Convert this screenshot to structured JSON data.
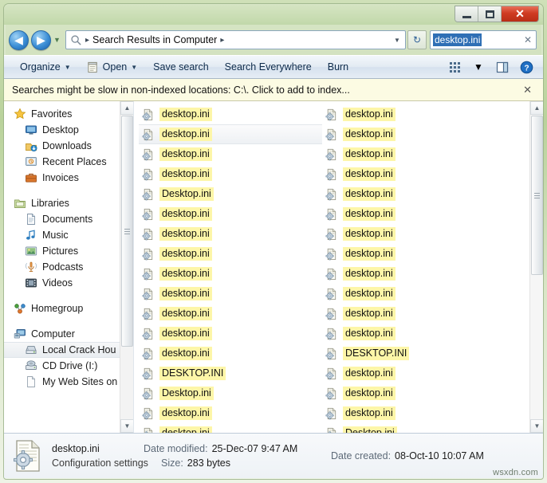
{
  "window": {
    "title": "",
    "controls": {
      "minimize": "minimize-icon",
      "maximize": "maximize-icon",
      "close": "✕"
    }
  },
  "address": {
    "back_label": "◀",
    "forward_label": "▶",
    "history_caret": "▼",
    "search_icon": "magnifier-icon",
    "crumb_sep": "▸",
    "breadcrumb": "Search Results in Computer",
    "dropdown_caret": "▼",
    "refresh_label": "↻"
  },
  "search": {
    "value": "desktop.ini",
    "clear_label": "✕"
  },
  "toolbar": {
    "organize": "Organize",
    "open": "Open",
    "save_search": "Save search",
    "search_everywhere": "Search Everywhere",
    "burn": "Burn",
    "caret": "▼",
    "views_icon": "view-options-icon",
    "preview_icon": "preview-pane-icon",
    "help_icon": "help-icon"
  },
  "notice": {
    "text": "Searches might be slow in non-indexed locations: C:\\. Click to add to index...",
    "close_label": "✕"
  },
  "sidebar": {
    "groups": [
      {
        "header": {
          "label": "Favorites",
          "icon": "star-icon"
        },
        "items": [
          {
            "label": "Desktop",
            "icon": "desktop-icon"
          },
          {
            "label": "Downloads",
            "icon": "downloads-icon"
          },
          {
            "label": "Recent Places",
            "icon": "recent-places-icon"
          },
          {
            "label": "Invoices",
            "icon": "briefcase-icon"
          }
        ]
      },
      {
        "header": {
          "label": "Libraries",
          "icon": "library-icon"
        },
        "items": [
          {
            "label": "Documents",
            "icon": "document-icon"
          },
          {
            "label": "Music",
            "icon": "music-note-icon"
          },
          {
            "label": "Pictures",
            "icon": "picture-icon"
          },
          {
            "label": "Podcasts",
            "icon": "podcast-icon"
          },
          {
            "label": "Videos",
            "icon": "video-icon"
          }
        ]
      },
      {
        "header": {
          "label": "Homegroup",
          "icon": "homegroup-icon"
        },
        "items": []
      },
      {
        "header": {
          "label": "Computer",
          "icon": "computer-icon"
        },
        "items": [
          {
            "label": "Local Crack Hou",
            "icon": "hard-drive-icon",
            "selected": true
          },
          {
            "label": "CD Drive (I:)",
            "icon": "cd-drive-icon"
          },
          {
            "label": "My Web Sites on",
            "icon": "web-sites-icon"
          }
        ]
      }
    ],
    "scrollbar": {
      "up": "▲",
      "down": "▼"
    }
  },
  "filelist": {
    "columns": [
      {
        "rows": [
          {
            "name": "desktop.ini"
          },
          {
            "name": "desktop.ini",
            "selected": true
          },
          {
            "name": "desktop.ini"
          },
          {
            "name": "desktop.ini"
          },
          {
            "name": "Desktop.ini"
          },
          {
            "name": "desktop.ini"
          },
          {
            "name": "desktop.ini"
          },
          {
            "name": "desktop.ini"
          },
          {
            "name": "desktop.ini"
          },
          {
            "name": "desktop.ini"
          },
          {
            "name": "desktop.ini"
          },
          {
            "name": "desktop.ini"
          },
          {
            "name": "desktop.ini"
          },
          {
            "name": "DESKTOP.INI"
          },
          {
            "name": "Desktop.ini"
          },
          {
            "name": "desktop.ini"
          },
          {
            "name": "desktop.ini"
          }
        ]
      },
      {
        "rows": [
          {
            "name": "desktop.ini"
          },
          {
            "name": "desktop.ini"
          },
          {
            "name": "desktop.ini"
          },
          {
            "name": "desktop.ini"
          },
          {
            "name": "desktop.ini"
          },
          {
            "name": "desktop.ini"
          },
          {
            "name": "desktop.ini"
          },
          {
            "name": "desktop.ini"
          },
          {
            "name": "desktop.ini"
          },
          {
            "name": "desktop.ini"
          },
          {
            "name": "desktop.ini"
          },
          {
            "name": "desktop.ini"
          },
          {
            "name": "DESKTOP.INI"
          },
          {
            "name": "desktop.ini"
          },
          {
            "name": "desktop.ini"
          },
          {
            "name": "desktop.ini"
          },
          {
            "name": "Desktop.ini"
          }
        ]
      }
    ],
    "scrollbar": {
      "up": "▲",
      "down": "▼"
    }
  },
  "status": {
    "file_name": "desktop.ini",
    "file_type": "Configuration settings",
    "date_modified_label": "Date modified:",
    "date_modified_value": "25-Dec-07 9:47 AM",
    "size_label": "Size:",
    "size_value": "283 bytes",
    "date_created_label": "Date created:",
    "date_created_value": "08-Oct-10 10:07 AM",
    "icon": "ini-file-icon"
  },
  "watermark": "wsxdn.com",
  "colors": {
    "highlight_yellow": "#fdf6a8",
    "search_selection_blue": "#2f6fb5",
    "notice_bg": "#fcfbe3",
    "close_button_red": "#cf3b22"
  }
}
